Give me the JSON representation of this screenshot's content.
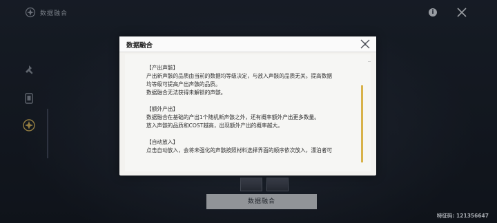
{
  "topbar": {
    "title": "数据融合",
    "icons": {
      "title": "star-gear-icon",
      "info": "info-icon",
      "close": "close-x-icon"
    }
  },
  "info_button": {
    "label": "i"
  },
  "sidebar": {
    "items": [
      {
        "icon": "wrench-icon"
      },
      {
        "icon": "card-icon"
      },
      {
        "icon": "star-gear-icon",
        "active": true
      }
    ]
  },
  "dialog": {
    "title": "数据融合",
    "close_icon": "close-x-icon",
    "sections": [
      {
        "heading": "【产出声骸】",
        "lines": [
          "产出新声骸的品质由当前的数据均等级决定，与放入声骸的品质无关。提高数据",
          "均等级可提高产出声骸的品质。",
          "数据融合无法获得未解锁的声骸。"
        ]
      },
      {
        "heading": "【额外产出】",
        "lines": [
          "数据融合在基础的产出1个随机新声骸之外，还有概率额外产出更多数量。",
          "放入声骸的品质和COST越高，出现额外产出的概率越大。"
        ]
      },
      {
        "heading": "【自动放入】",
        "lines": [
          "点击自动放入，会将未强化的声骸按照材料选择界面的顺序依次放入，漂泊者可"
        ]
      }
    ]
  },
  "bottom": {
    "button_label": "数据融合",
    "feature_code": "特征码: 121356647"
  },
  "colors": {
    "background": "#161b25",
    "dialog_bg": "#f3f2ef",
    "scroll_accent": "#d8b24a",
    "button_bg": "#bfc2c6"
  }
}
